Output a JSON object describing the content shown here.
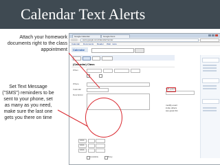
{
  "slide": {
    "title": "Calendar Text Alerts",
    "caption_top": "Attach your homework documents right to the class appointment",
    "caption_bottom": "Set Text Message (\"SMS\") reminders to be sent to your phone, set as many as you need, make sure the last one gets you there on time"
  },
  "browser": {
    "tab_1": "Google Calendar",
    "tab_2": "Google Docs",
    "url": "www.google.com/calendar/render"
  },
  "google_bar": {
    "links": [
      "Calendar",
      "Documents",
      "Reader",
      "Web",
      "more"
    ]
  },
  "calendar": {
    "logo": "Calendar",
    "event_name": "(Calendar) Class",
    "fields": [
      "When",
      "Where",
      "Calendar",
      "Description"
    ],
    "guests_label": "Add guests",
    "guest_options": [
      "modify event",
      "invite others",
      "see guest list"
    ],
    "reminders": [
      "SMS",
      "SMS",
      "SMS"
    ],
    "show_me_as": [
      "Available",
      "Busy"
    ]
  },
  "colors": {
    "title_bar": "#3f4a52",
    "highlight": "#d9262d",
    "accent": "#2a5db0"
  }
}
